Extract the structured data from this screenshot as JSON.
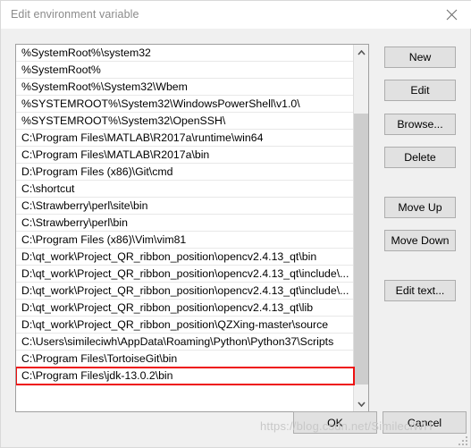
{
  "window": {
    "title": "Edit environment variable",
    "close_icon": "close-icon"
  },
  "list": {
    "scroll_up_icon": "chevron-up-icon",
    "scroll_down_icon": "chevron-down-icon",
    "highlighted_index": 19,
    "items": [
      "%SystemRoot%\\system32",
      "%SystemRoot%",
      "%SystemRoot%\\System32\\Wbem",
      "%SYSTEMROOT%\\System32\\WindowsPowerShell\\v1.0\\",
      "%SYSTEMROOT%\\System32\\OpenSSH\\",
      "C:\\Program Files\\MATLAB\\R2017a\\runtime\\win64",
      "C:\\Program Files\\MATLAB\\R2017a\\bin",
      "D:\\Program Files (x86)\\Git\\cmd",
      "C:\\shortcut",
      "C:\\Strawberry\\perl\\site\\bin",
      "C:\\Strawberry\\perl\\bin",
      "C:\\Program Files (x86)\\Vim\\vim81",
      "D:\\qt_work\\Project_QR_ribbon_position\\opencv2.4.13_qt\\bin",
      "D:\\qt_work\\Project_QR_ribbon_position\\opencv2.4.13_qt\\include\\...",
      "D:\\qt_work\\Project_QR_ribbon_position\\opencv2.4.13_qt\\include\\...",
      "D:\\qt_work\\Project_QR_ribbon_position\\opencv2.4.13_qt\\lib",
      "D:\\qt_work\\Project_QR_ribbon_position\\QZXing-master\\source",
      "C:\\Users\\simileciwh\\AppData\\Roaming\\Python\\Python37\\Scripts",
      "C:\\Program Files\\TortoiseGit\\bin",
      "C:\\Program Files\\jdk-13.0.2\\bin"
    ]
  },
  "buttons": {
    "new": "New",
    "edit": "Edit",
    "browse": "Browse...",
    "delete": "Delete",
    "move_up": "Move Up",
    "move_down": "Move Down",
    "edit_text": "Edit text...",
    "ok": "OK",
    "cancel": "Cancel"
  },
  "watermark": "https://blog.csdn.net/SimileciWH",
  "colors": {
    "highlight_border": "#ee1111",
    "button_face": "#e1e1e1",
    "button_border": "#adadad",
    "dialog_background": "#f0f0f0",
    "titlebar_background": "#ffffff",
    "title_text": "#8b8b8b",
    "scrollbar_thumb": "#cdcdcd"
  }
}
